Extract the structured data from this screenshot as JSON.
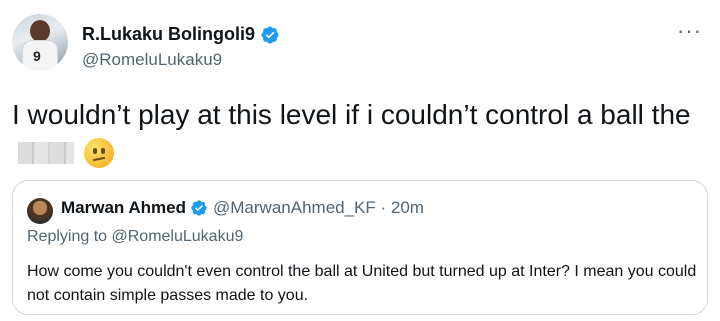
{
  "author": {
    "display_name": "R.Lukaku Bolingoli9",
    "handle": "@RomeluLukaku9",
    "avatar_jersey_number": "9"
  },
  "tweet": {
    "text": "I wouldn’t play at this level if i couldn’t control a ball the",
    "censored_word": "blurred",
    "emoji": "confused-face"
  },
  "quoted_tweet": {
    "display_name": "Marwan Ahmed",
    "handle_and_time": "@MarwanAhmed_KF · 20m",
    "replying_to": "Replying to @RomeluLukaku9",
    "text": "How come you couldn't even control the ball at United but turned up at Inter? I mean you could not contain simple passes made to you."
  },
  "colors": {
    "verified_blue": "#1d9bf0",
    "secondary_text": "#536471",
    "border": "#cfd9de"
  },
  "icons": {
    "more": "more-icon",
    "verified": "verified-badge-icon"
  }
}
